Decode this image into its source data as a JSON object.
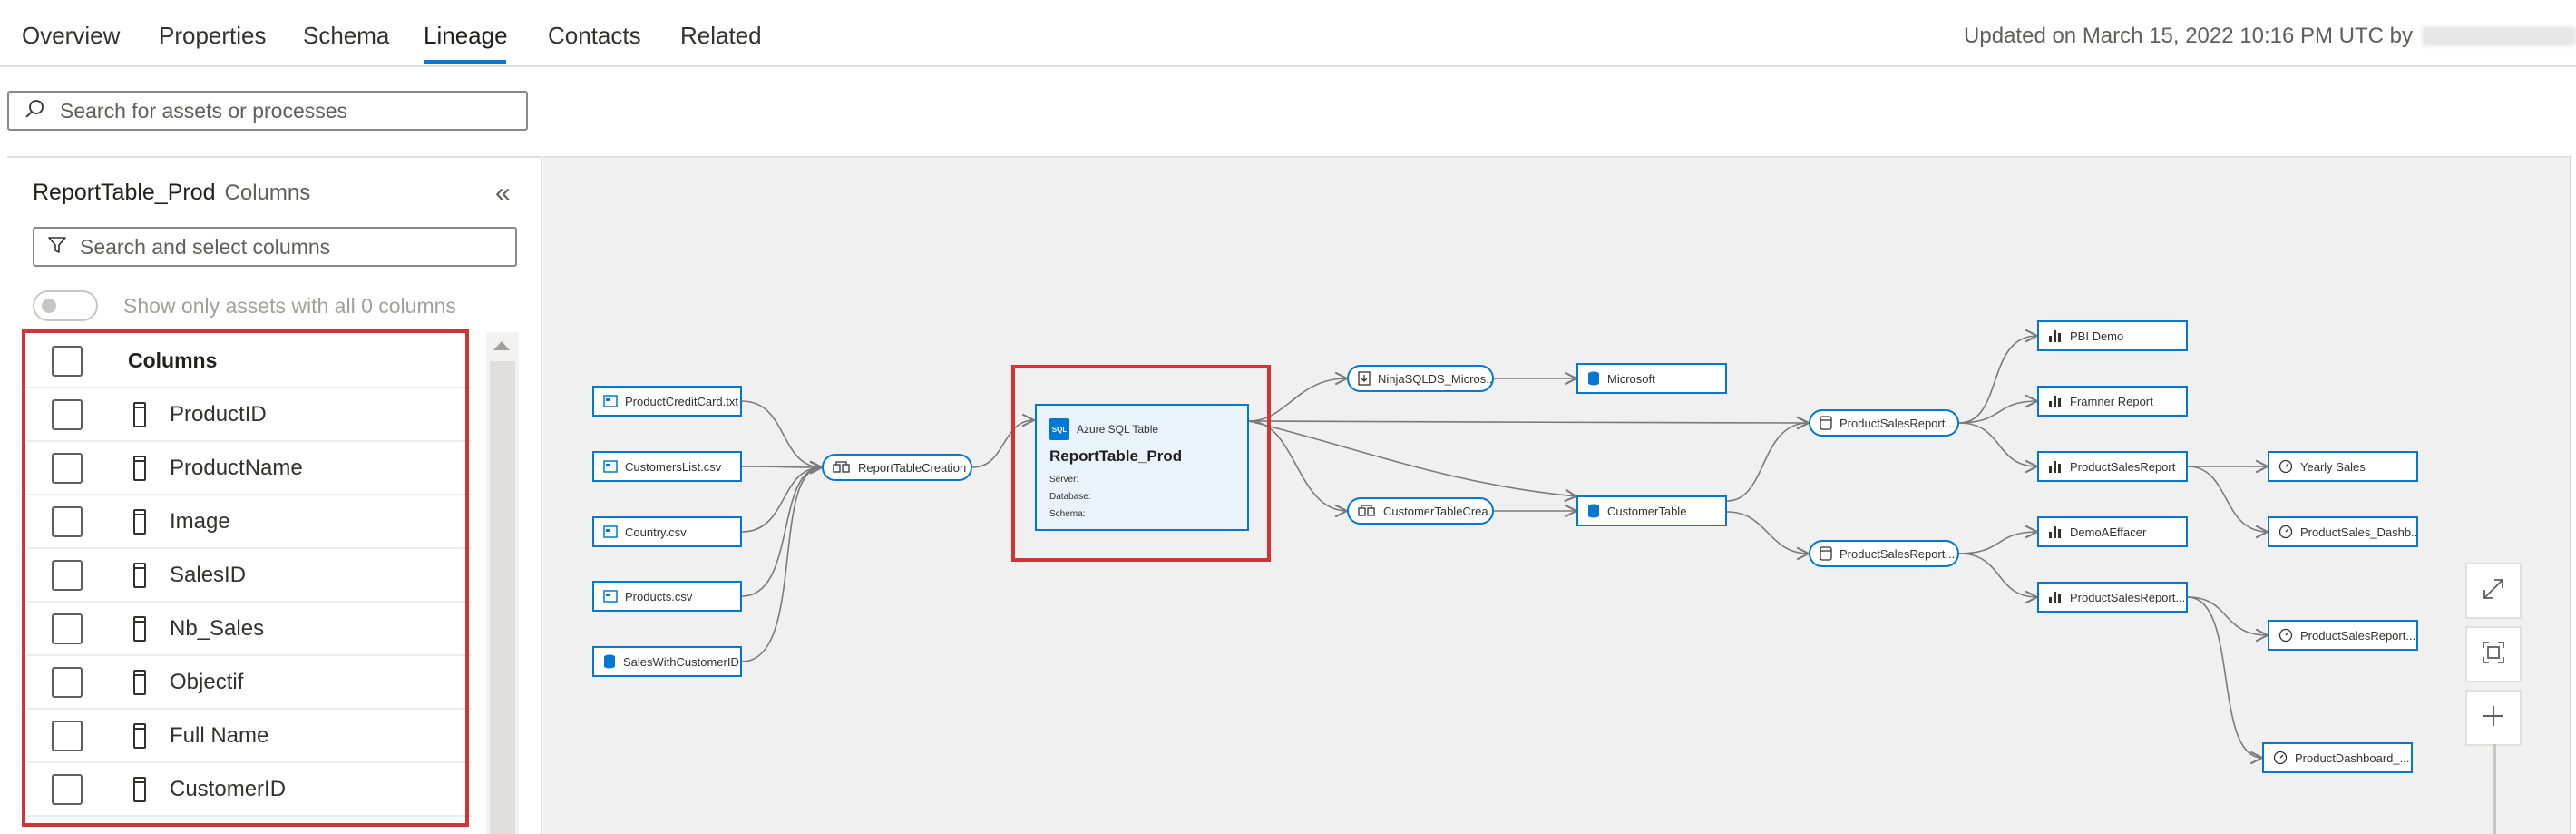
{
  "tabs": [
    {
      "label": "Overview"
    },
    {
      "label": "Properties"
    },
    {
      "label": "Schema"
    },
    {
      "label": "Lineage"
    },
    {
      "label": "Contacts"
    },
    {
      "label": "Related"
    }
  ],
  "active_tab": "Lineage",
  "updated_text": "Updated on March 15, 2022 10:16 PM UTC by",
  "search": {
    "placeholder": "Search for assets or processes"
  },
  "panel": {
    "asset_name": "ReportTable_Prod",
    "subtitle": "Columns",
    "column_search_placeholder": "Search and select columns",
    "toggle_label": "Show only assets with all 0 columns",
    "header": "Columns",
    "columns": [
      "ProductID",
      "ProductName",
      "Image",
      "SalesID",
      "Nb_Sales",
      "Objectif",
      "Full Name",
      "CustomerID"
    ]
  },
  "lineage": {
    "main": {
      "type_label": "Azure SQL Table",
      "title": "ReportTable_Prod",
      "server_label": "Server:",
      "database_label": "Database:",
      "schema_label": "Schema:"
    },
    "sources": [
      "ProductCreditCard.txt",
      "CustomersList.csv",
      "Country.csv",
      "Products.csv",
      "SalesWithCustomerID"
    ],
    "process_report": "ReportTableCreation",
    "process_ninja": "NinjaSQLDS_Micros...",
    "microsoft": "Microsoft",
    "process_customer": "CustomerTableCrea...",
    "customer_table": "CustomerTable",
    "process_sales_1": "ProductSalesReport...",
    "process_sales_2": "ProductSalesReport...",
    "reports": {
      "pbi_demo": "PBI Demo",
      "framner": "Framner Report",
      "product_sales_report": "ProductSalesReport",
      "demo_aeffacer": "DemoAEffacer",
      "product_sales_report_2": "ProductSalesReport..."
    },
    "dashboards": {
      "yearly_sales": "Yearly Sales",
      "product_sales_dash": "ProductSales_Dashb...",
      "product_sales_report_dash": "ProductSalesReport...",
      "product_dashboard": "ProductDashboard_..."
    }
  },
  "colors": {
    "accent": "#0078d4",
    "highlight": "#d13438"
  }
}
